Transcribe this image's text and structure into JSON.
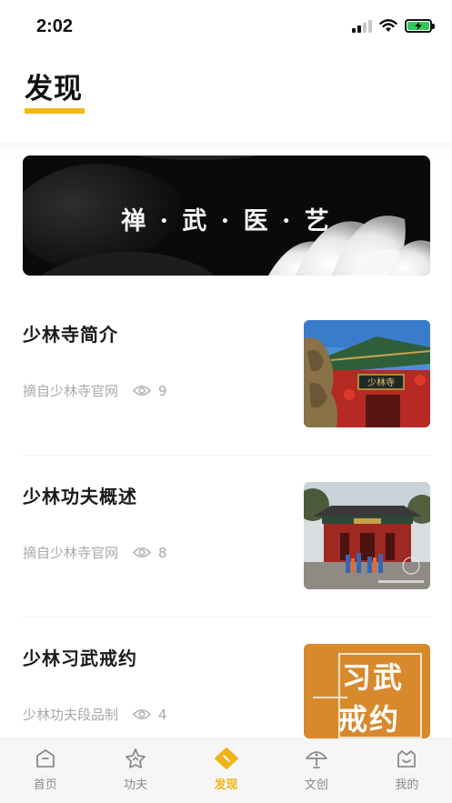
{
  "status": {
    "time": "2:02",
    "battery_color": "#34c759"
  },
  "header": {
    "title": "发现",
    "accent_color": "#f0bb1a"
  },
  "banner": {
    "text": "禅 · 武 · 医 · 艺"
  },
  "articles": [
    {
      "title": "少林寺简介",
      "source": "摘自少林寺官网",
      "views": "9",
      "thumb": "temple-gate-image"
    },
    {
      "title": "少林功夫概述",
      "source": "摘自少林寺官网",
      "views": "8",
      "thumb": "kungfu-performance-image"
    },
    {
      "title": "少林习武戒约",
      "source": "少林功夫段品制",
      "views": "4",
      "thumb": "xiwu-jieyue-image",
      "thumb_text_top": "习武",
      "thumb_text_bottom": "戒约"
    }
  ],
  "tabs": [
    {
      "label": "首页",
      "icon": "home-icon",
      "active": false
    },
    {
      "label": "功夫",
      "icon": "kungfu-icon",
      "active": false
    },
    {
      "label": "发现",
      "icon": "discover-icon",
      "active": true
    },
    {
      "label": "文创",
      "icon": "culture-icon",
      "active": false
    },
    {
      "label": "我的",
      "icon": "profile-icon",
      "active": false
    }
  ],
  "colors": {
    "tab_active": "#f0b514",
    "tab_inactive": "#888888"
  }
}
